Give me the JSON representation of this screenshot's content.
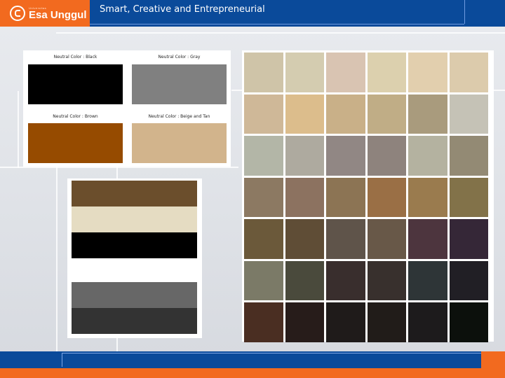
{
  "header": {
    "logo_sub": "Universitas",
    "logo_text": "Esa Unggul",
    "tagline": "Smart, Creative and Entrepreneurial",
    "colors": {
      "blue": "#0a4a9a",
      "orange": "#f26a1f"
    }
  },
  "neutral_colors": [
    {
      "label": "Neutral Color : Black",
      "color": "#000000"
    },
    {
      "label": "Neutral Color : Gray",
      "color": "#808080"
    },
    {
      "label": "Neutral Color : Brown",
      "color": "#964b00"
    },
    {
      "label": "Neutral Color : Beige and Tan",
      "color": "#d2b48c"
    }
  ],
  "stripes": [
    {
      "color": "#6b4e2c"
    },
    {
      "color": "#e5dcc2"
    },
    {
      "color": "#000000"
    },
    {
      "color": "#ffffff"
    },
    {
      "color": "#676767"
    },
    {
      "color": "#333333"
    }
  ],
  "palette_grid": [
    [
      "#cfc4a8",
      "#d4ccb0",
      "#d9c4b2",
      "#dcd0ae",
      "#e2cfae",
      "#dccbac"
    ],
    [
      "#cfb898",
      "#dcbd8c",
      "#c9b088",
      "#c0ad86",
      "#a99b7d",
      "#c5c2b6"
    ],
    [
      "#b3b6a7",
      "#aeaa9f",
      "#918784",
      "#8e837d",
      "#b4b2a0",
      "#938a74"
    ],
    [
      "#8c7962",
      "#8c7260",
      "#8c7454",
      "#9a6f45",
      "#9a7b4e",
      "#827249"
    ],
    [
      "#6b593a",
      "#5f4d36",
      "#5f544a",
      "#685848",
      "#4d353e",
      "#352737"
    ],
    [
      "#7b7a67",
      "#4a4a3c",
      "#392e2d",
      "#38302d",
      "#2e3537",
      "#211f25"
    ],
    [
      "#4a2e22",
      "#271c1a",
      "#1f1b1a",
      "#211c19",
      "#1d1b1c",
      "#0c100c"
    ]
  ]
}
